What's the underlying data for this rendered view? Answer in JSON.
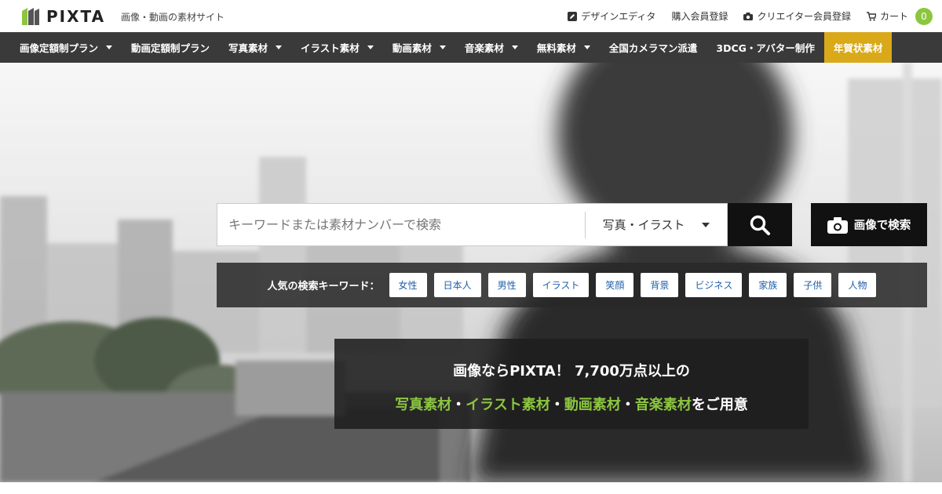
{
  "header": {
    "logo_text": "PIXTA",
    "tagline": "画像・動画の素材サイト",
    "utility": [
      {
        "label": "デザインエディタ",
        "icon": "edit-icon"
      },
      {
        "label": "購入会員登録",
        "icon": ""
      },
      {
        "label": "クリエイター会員登録",
        "icon": "camera-icon"
      },
      {
        "label": "カート",
        "icon": "cart-icon"
      }
    ],
    "cart_count": "0"
  },
  "nav": {
    "items": [
      {
        "label": "画像定額制プラン",
        "dropdown": true
      },
      {
        "label": "動画定額制プラン",
        "dropdown": false
      },
      {
        "label": "写真素材",
        "dropdown": true
      },
      {
        "label": "イラスト素材",
        "dropdown": true
      },
      {
        "label": "動画素材",
        "dropdown": true
      },
      {
        "label": "音楽素材",
        "dropdown": true
      },
      {
        "label": "無料素材",
        "dropdown": true
      },
      {
        "label": "全国カメラマン派遣",
        "dropdown": false
      },
      {
        "label": "3DCG・アバター制作",
        "dropdown": false
      },
      {
        "label": "年賀状素材",
        "dropdown": false,
        "highlight": true
      }
    ],
    "highlight_color": "#d9a919"
  },
  "search": {
    "placeholder": "キーワードまたは素材ナンバーで検索",
    "value": "",
    "category": "写真・イラスト",
    "image_search_label": "画像で検索"
  },
  "keywords": {
    "label": "人気の検索キーワード：",
    "tags": [
      "女性",
      "日本人",
      "男性",
      "イラスト",
      "笑顔",
      "背景",
      "ビジネス",
      "家族",
      "子供",
      "人物"
    ]
  },
  "promo": {
    "line1": "画像ならPIXTA！ 7,700万点以上の",
    "line2_parts": [
      {
        "text": "写真素材",
        "accent": true
      },
      {
        "text": "・",
        "accent": false
      },
      {
        "text": "イラスト素材",
        "accent": true
      },
      {
        "text": "・",
        "accent": false
      },
      {
        "text": "動画素材",
        "accent": true
      },
      {
        "text": "・",
        "accent": false
      },
      {
        "text": "音楽素材",
        "accent": true
      },
      {
        "text": "をご用意",
        "accent": false
      }
    ],
    "accent_color": "#8cc63f"
  }
}
